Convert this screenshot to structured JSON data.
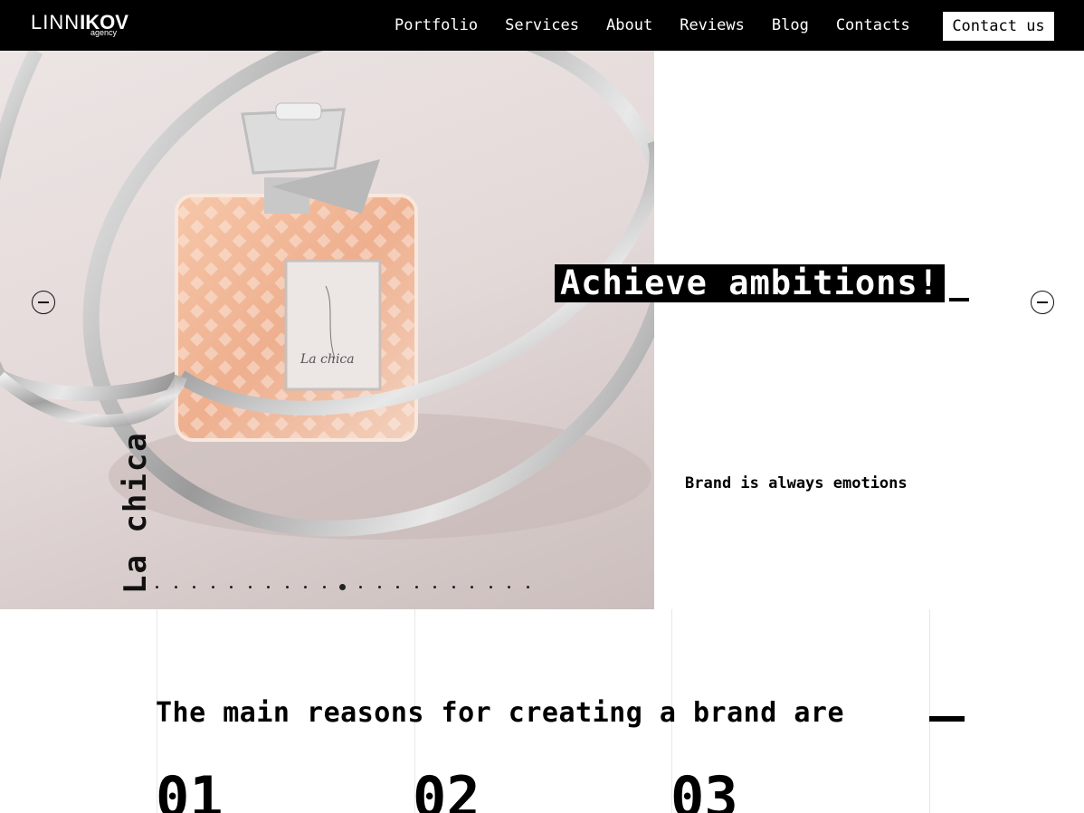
{
  "brand": {
    "name_light": "LINN",
    "name_bold": "IKOV",
    "sub": "agency"
  },
  "nav": {
    "items": [
      "Portfolio",
      "Services",
      "About",
      "Reviews",
      "Blog",
      "Contacts"
    ],
    "cta": "Contact us"
  },
  "hero": {
    "product_title": "La chica",
    "headline": "Achieve ambitions!",
    "tagline": "Brand is always emotions",
    "slides": {
      "count": 21,
      "active_index": 10
    },
    "label_script": "La chica"
  },
  "reasons": {
    "title": "The main reasons for creating a brand are",
    "numbers": [
      "01",
      "02",
      "03"
    ]
  },
  "icons": {
    "prev": "arrow-left-icon",
    "next": "arrow-right-icon"
  },
  "colors": {
    "header_bg": "#000000",
    "accent": "#000000",
    "page_bg": "#ffffff"
  }
}
